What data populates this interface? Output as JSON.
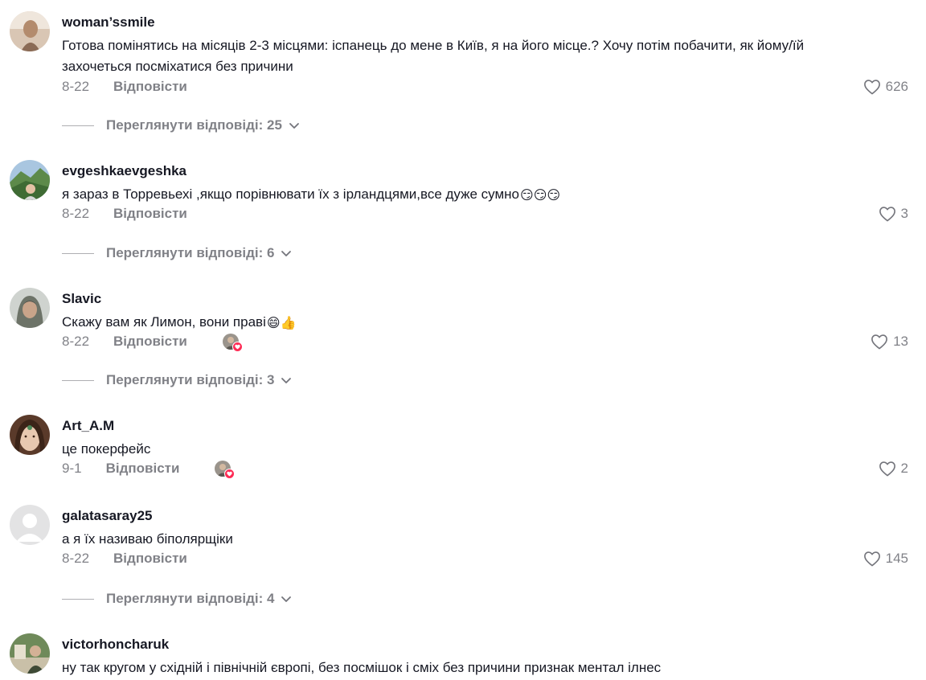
{
  "reply_label": "Відповісти",
  "view_replies_prefix": "Переглянути відповіді: ",
  "comments": [
    {
      "username": "woman’ssmile",
      "text": "Готова помінятись на місяців 2-3 місцями: іспанець до мене в Київ, я на його місце.? Хочу потім побачити, як йому/їй захочеться посміхатися без причини",
      "emoji": "",
      "date": "8-22",
      "likes": "626",
      "replies_count": "25"
    },
    {
      "username": "evgeshkaevgeshka",
      "text": "я зараз в Торревьехі ,якщо порівнювати їх з ірландцями,все дуже сумно",
      "emoji": "😏😏😏",
      "date": "8-22",
      "likes": "3",
      "replies_count": "6"
    },
    {
      "username": "Slavic",
      "text": "Скажу вам як Лимон, вони праві",
      "emoji": "😄👍",
      "date": "8-22",
      "likes": "13",
      "replies_count": "3",
      "creator_liked": true
    },
    {
      "username": "Art_A.M",
      "text": "це покерфейс",
      "emoji": "",
      "date": "9-1",
      "likes": "2",
      "creator_liked": true
    },
    {
      "username": "galatasaray25",
      "text": "а я їх називаю біполярщіки",
      "emoji": "",
      "date": "8-22",
      "likes": "145",
      "replies_count": "4"
    },
    {
      "username": "victorhoncharuk",
      "text": "ну так кругом у східній і північній європі, без посмішок і сміх без причини признак ментал ілнес",
      "emoji": ""
    }
  ],
  "colors": {
    "primary_text": "#161823",
    "secondary_text": "rgba(22,24,35,0.55)",
    "like_badge": "#fe2c55"
  },
  "icons": {
    "like": "heart-outline-icon",
    "expand": "chevron-down-icon",
    "creator_like_badge": "heart-filled-icon"
  }
}
